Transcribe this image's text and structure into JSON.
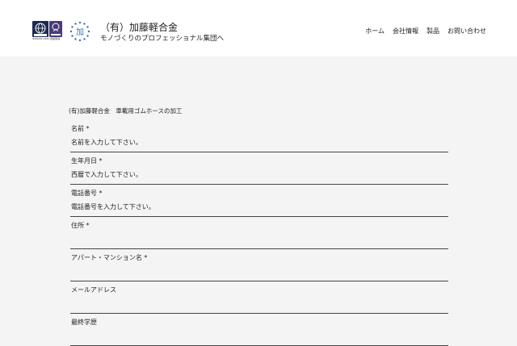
{
  "header": {
    "cert_logo_text": "ISO9001:2015 認証取得",
    "emblem_char": "加",
    "company_name": "（有）加藤軽合金",
    "tagline": "モノづくりのプロフェッショナル集団へ"
  },
  "nav": {
    "items": [
      {
        "label": "ホーム"
      },
      {
        "label": "会社情報"
      },
      {
        "label": "製品"
      },
      {
        "label": "お問い合わせ"
      }
    ]
  },
  "form": {
    "title": "(有)加藤軽合金　車載用ゴムホースの加工",
    "fields": [
      {
        "label": "名前 *",
        "placeholder": "名前を入力して下さい。"
      },
      {
        "label": "生年月日 *",
        "placeholder": "西暦で入力して下さい。"
      },
      {
        "label": "電話番号 *",
        "placeholder": "電話番号を入力して下さい。"
      },
      {
        "label": "住所 *",
        "placeholder": ""
      },
      {
        "label": "アパート・マンション名 *",
        "placeholder": ""
      },
      {
        "label": "メールアドレス",
        "placeholder": ""
      },
      {
        "label": "最終学歴",
        "placeholder": ""
      }
    ]
  },
  "colors": {
    "background": "#f4f4f4",
    "header_bg": "#ffffff",
    "field_border": "#444444",
    "emblem_blue": "#3b6fb6"
  }
}
